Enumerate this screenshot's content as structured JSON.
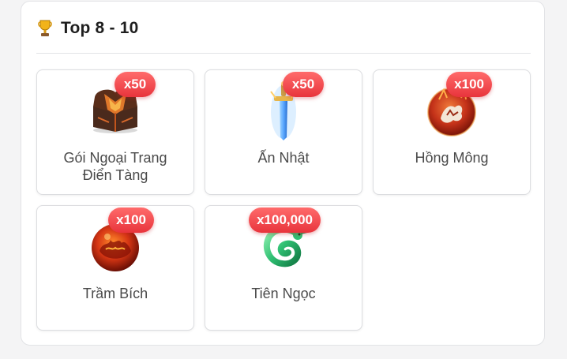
{
  "section": {
    "icon": "trophy-icon",
    "title": "Top 8 - 10"
  },
  "colors": {
    "badge": "#e8343c",
    "text": "#4a4a4a",
    "title": "#1f1f1f"
  },
  "items": [
    {
      "name": "Gói Ngoại Trang\nĐiển Tàng",
      "quantity": "x50",
      "icon": "treasure-chest-icon"
    },
    {
      "name": "Ấn Nhật",
      "quantity": "x50",
      "icon": "sword-icon"
    },
    {
      "name": "Hồng Mông",
      "quantity": "x100",
      "icon": "red-beast-orb-icon"
    },
    {
      "name": "Trầm Bích",
      "quantity": "x100",
      "icon": "fire-orb-icon"
    },
    {
      "name": "Tiên Ngọc",
      "quantity": "x100,000",
      "icon": "jade-dragon-icon"
    }
  ]
}
